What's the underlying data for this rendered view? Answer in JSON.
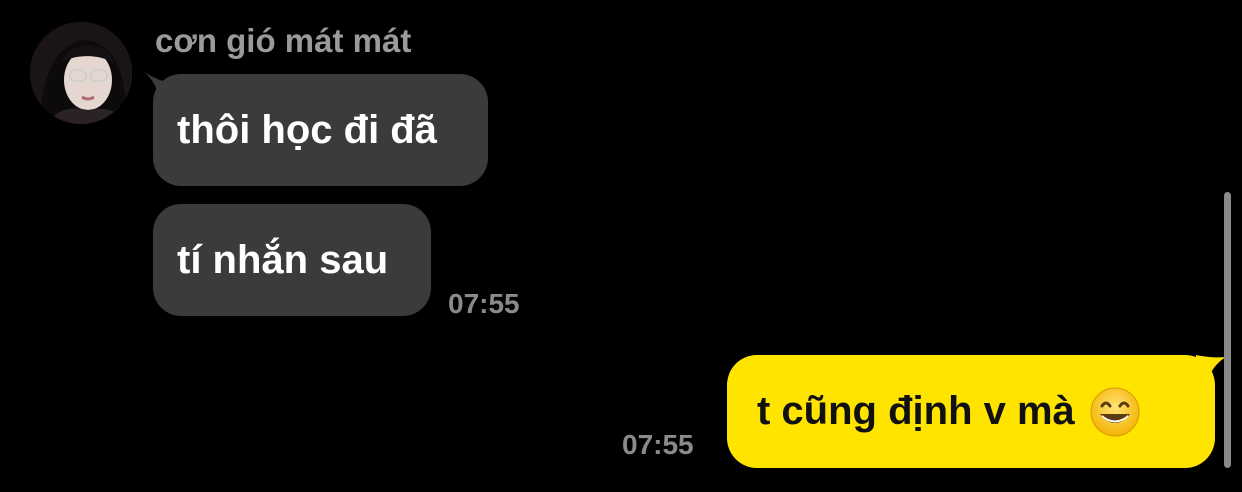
{
  "conversation": {
    "sender_name": "cơn gió mát mát",
    "avatar_icon": "profile-photo-avatar",
    "incoming": [
      {
        "text": "thôi học đi đã"
      },
      {
        "text": "tí nhắn sau",
        "time": "07:55"
      }
    ],
    "outgoing": [
      {
        "text": "t cũng định v mà",
        "emoji": "grinning-face-emoji",
        "time": "07:55"
      }
    ]
  },
  "colors": {
    "background": "#000000",
    "incoming_bubble": "#3b3b3b",
    "outgoing_bubble": "#ffe400",
    "meta_text": "#8a8a8a"
  }
}
